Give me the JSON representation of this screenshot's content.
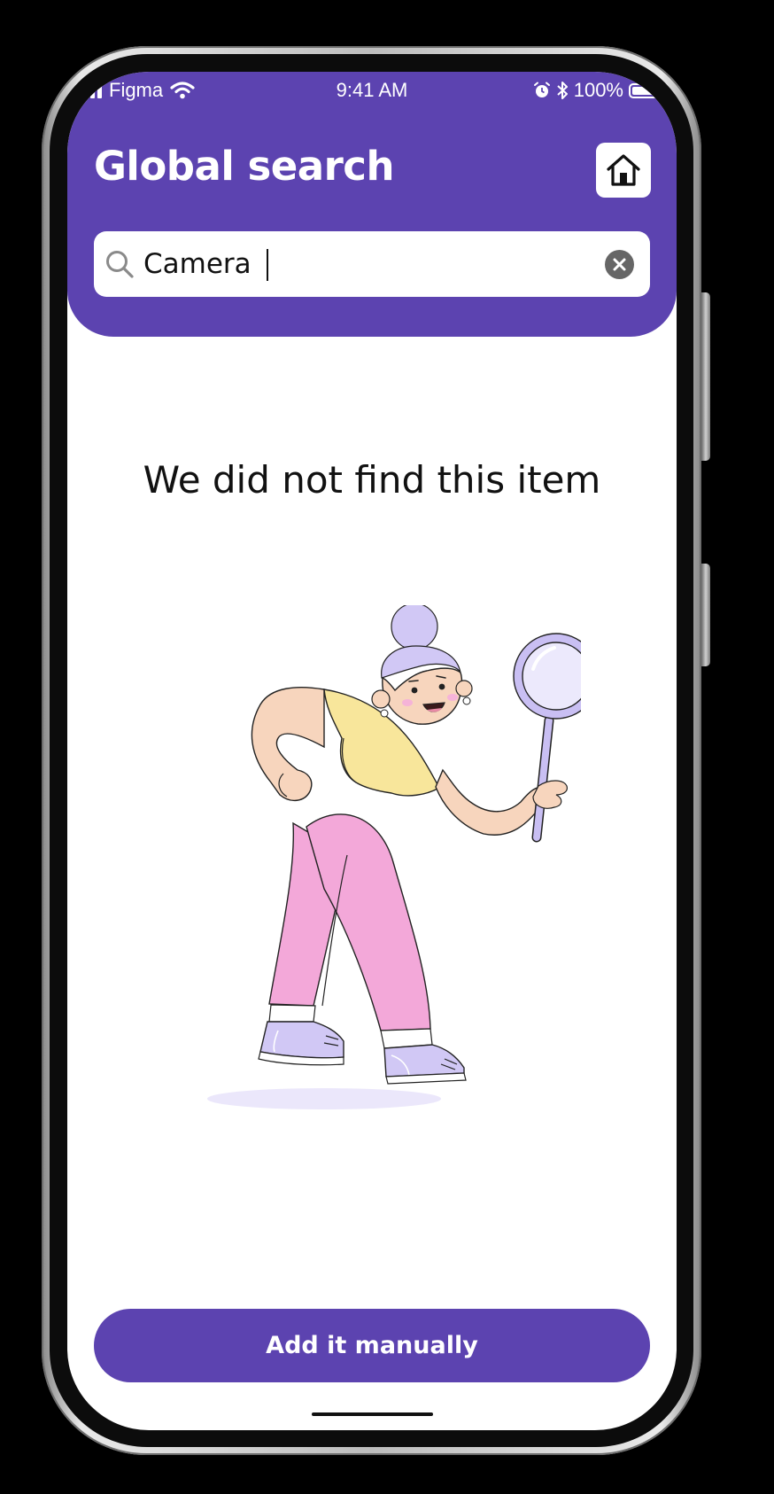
{
  "status_bar": {
    "carrier": "Figma",
    "time": "9:41 AM",
    "battery_percent": "100%",
    "icons": [
      "signal-icon",
      "wifi-icon",
      "alarm-icon",
      "bluetooth-icon",
      "battery-icon"
    ]
  },
  "header": {
    "title": "Global search",
    "home_icon": "home-icon",
    "background_color": "#5c43b0"
  },
  "search": {
    "value": "Camera",
    "icon": "search-icon",
    "clear_icon": "clear-icon"
  },
  "main": {
    "empty_message": "We did not find this item",
    "illustration": "person-with-magnifying-glass-illustration"
  },
  "footer": {
    "add_button_label": "Add it manually",
    "button_color": "#5c43b0"
  }
}
